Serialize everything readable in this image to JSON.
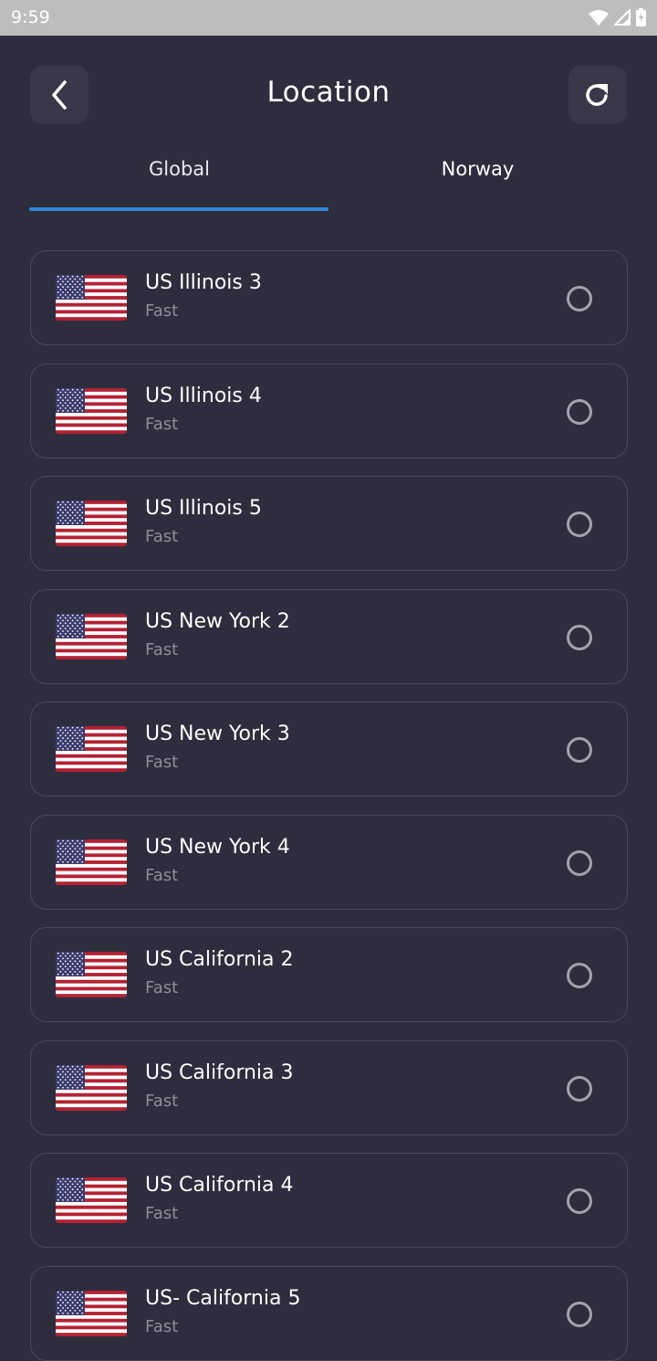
{
  "status_bar": {
    "time": "9:59",
    "icons": [
      "wifi-icon",
      "cell-signal-icon",
      "battery-charging-icon"
    ]
  },
  "header": {
    "title": "Location",
    "back_icon": "chevron-left-icon",
    "refresh_icon": "refresh-icon"
  },
  "tabs": [
    {
      "label": "Global",
      "selected": true
    },
    {
      "label": "Norway",
      "selected": false
    }
  ],
  "colors": {
    "background": "#2e2d3d",
    "accent": "#2f86d8",
    "card_border": "#4a4959",
    "secondary_text": "#8e8d99"
  },
  "servers": [
    {
      "name": "US Illinois 3",
      "speed": "Fast",
      "flag": "us-flag",
      "selected": false
    },
    {
      "name": "US Illinois 4",
      "speed": "Fast",
      "flag": "us-flag",
      "selected": false
    },
    {
      "name": "US Illinois 5",
      "speed": "Fast",
      "flag": "us-flag",
      "selected": false
    },
    {
      "name": "US New York 2",
      "speed": "Fast",
      "flag": "us-flag",
      "selected": false
    },
    {
      "name": "US New York 3",
      "speed": "Fast",
      "flag": "us-flag",
      "selected": false
    },
    {
      "name": "US New York 4",
      "speed": "Fast",
      "flag": "us-flag",
      "selected": false
    },
    {
      "name": "US California 2",
      "speed": "Fast",
      "flag": "us-flag",
      "selected": false
    },
    {
      "name": "US California 3",
      "speed": "Fast",
      "flag": "us-flag",
      "selected": false
    },
    {
      "name": "US California 4",
      "speed": "Fast",
      "flag": "us-flag",
      "selected": false
    },
    {
      "name": "US- California 5",
      "speed": "Fast",
      "flag": "us-flag",
      "selected": false
    }
  ]
}
